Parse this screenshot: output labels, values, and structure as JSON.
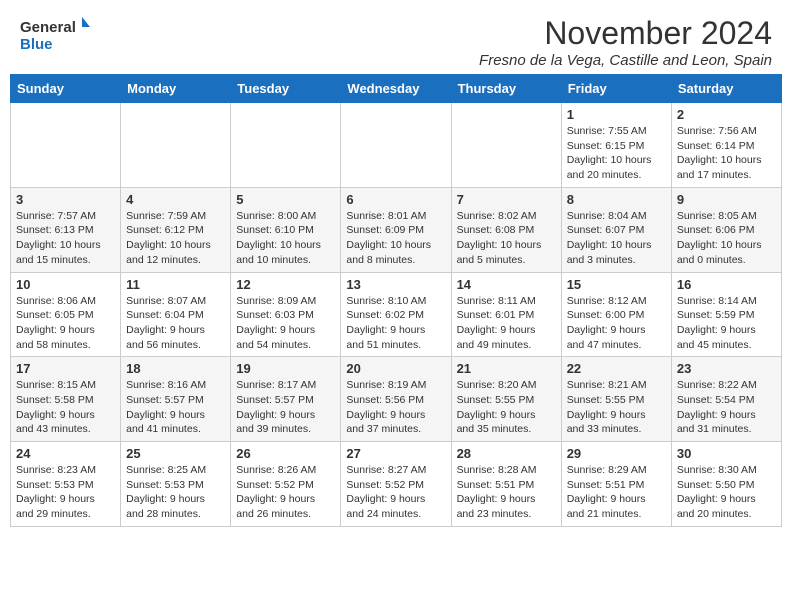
{
  "header": {
    "logo_general": "General",
    "logo_blue": "Blue",
    "month_year": "November 2024",
    "location": "Fresno de la Vega, Castille and Leon, Spain"
  },
  "days_of_week": [
    "Sunday",
    "Monday",
    "Tuesday",
    "Wednesday",
    "Thursday",
    "Friday",
    "Saturday"
  ],
  "weeks": [
    [
      {
        "day": "",
        "info": ""
      },
      {
        "day": "",
        "info": ""
      },
      {
        "day": "",
        "info": ""
      },
      {
        "day": "",
        "info": ""
      },
      {
        "day": "",
        "info": ""
      },
      {
        "day": "1",
        "info": "Sunrise: 7:55 AM\nSunset: 6:15 PM\nDaylight: 10 hours and 20 minutes."
      },
      {
        "day": "2",
        "info": "Sunrise: 7:56 AM\nSunset: 6:14 PM\nDaylight: 10 hours and 17 minutes."
      }
    ],
    [
      {
        "day": "3",
        "info": "Sunrise: 7:57 AM\nSunset: 6:13 PM\nDaylight: 10 hours and 15 minutes."
      },
      {
        "day": "4",
        "info": "Sunrise: 7:59 AM\nSunset: 6:12 PM\nDaylight: 10 hours and 12 minutes."
      },
      {
        "day": "5",
        "info": "Sunrise: 8:00 AM\nSunset: 6:10 PM\nDaylight: 10 hours and 10 minutes."
      },
      {
        "day": "6",
        "info": "Sunrise: 8:01 AM\nSunset: 6:09 PM\nDaylight: 10 hours and 8 minutes."
      },
      {
        "day": "7",
        "info": "Sunrise: 8:02 AM\nSunset: 6:08 PM\nDaylight: 10 hours and 5 minutes."
      },
      {
        "day": "8",
        "info": "Sunrise: 8:04 AM\nSunset: 6:07 PM\nDaylight: 10 hours and 3 minutes."
      },
      {
        "day": "9",
        "info": "Sunrise: 8:05 AM\nSunset: 6:06 PM\nDaylight: 10 hours and 0 minutes."
      }
    ],
    [
      {
        "day": "10",
        "info": "Sunrise: 8:06 AM\nSunset: 6:05 PM\nDaylight: 9 hours and 58 minutes."
      },
      {
        "day": "11",
        "info": "Sunrise: 8:07 AM\nSunset: 6:04 PM\nDaylight: 9 hours and 56 minutes."
      },
      {
        "day": "12",
        "info": "Sunrise: 8:09 AM\nSunset: 6:03 PM\nDaylight: 9 hours and 54 minutes."
      },
      {
        "day": "13",
        "info": "Sunrise: 8:10 AM\nSunset: 6:02 PM\nDaylight: 9 hours and 51 minutes."
      },
      {
        "day": "14",
        "info": "Sunrise: 8:11 AM\nSunset: 6:01 PM\nDaylight: 9 hours and 49 minutes."
      },
      {
        "day": "15",
        "info": "Sunrise: 8:12 AM\nSunset: 6:00 PM\nDaylight: 9 hours and 47 minutes."
      },
      {
        "day": "16",
        "info": "Sunrise: 8:14 AM\nSunset: 5:59 PM\nDaylight: 9 hours and 45 minutes."
      }
    ],
    [
      {
        "day": "17",
        "info": "Sunrise: 8:15 AM\nSunset: 5:58 PM\nDaylight: 9 hours and 43 minutes."
      },
      {
        "day": "18",
        "info": "Sunrise: 8:16 AM\nSunset: 5:57 PM\nDaylight: 9 hours and 41 minutes."
      },
      {
        "day": "19",
        "info": "Sunrise: 8:17 AM\nSunset: 5:57 PM\nDaylight: 9 hours and 39 minutes."
      },
      {
        "day": "20",
        "info": "Sunrise: 8:19 AM\nSunset: 5:56 PM\nDaylight: 9 hours and 37 minutes."
      },
      {
        "day": "21",
        "info": "Sunrise: 8:20 AM\nSunset: 5:55 PM\nDaylight: 9 hours and 35 minutes."
      },
      {
        "day": "22",
        "info": "Sunrise: 8:21 AM\nSunset: 5:55 PM\nDaylight: 9 hours and 33 minutes."
      },
      {
        "day": "23",
        "info": "Sunrise: 8:22 AM\nSunset: 5:54 PM\nDaylight: 9 hours and 31 minutes."
      }
    ],
    [
      {
        "day": "24",
        "info": "Sunrise: 8:23 AM\nSunset: 5:53 PM\nDaylight: 9 hours and 29 minutes."
      },
      {
        "day": "25",
        "info": "Sunrise: 8:25 AM\nSunset: 5:53 PM\nDaylight: 9 hours and 28 minutes."
      },
      {
        "day": "26",
        "info": "Sunrise: 8:26 AM\nSunset: 5:52 PM\nDaylight: 9 hours and 26 minutes."
      },
      {
        "day": "27",
        "info": "Sunrise: 8:27 AM\nSunset: 5:52 PM\nDaylight: 9 hours and 24 minutes."
      },
      {
        "day": "28",
        "info": "Sunrise: 8:28 AM\nSunset: 5:51 PM\nDaylight: 9 hours and 23 minutes."
      },
      {
        "day": "29",
        "info": "Sunrise: 8:29 AM\nSunset: 5:51 PM\nDaylight: 9 hours and 21 minutes."
      },
      {
        "day": "30",
        "info": "Sunrise: 8:30 AM\nSunset: 5:50 PM\nDaylight: 9 hours and 20 minutes."
      }
    ]
  ]
}
